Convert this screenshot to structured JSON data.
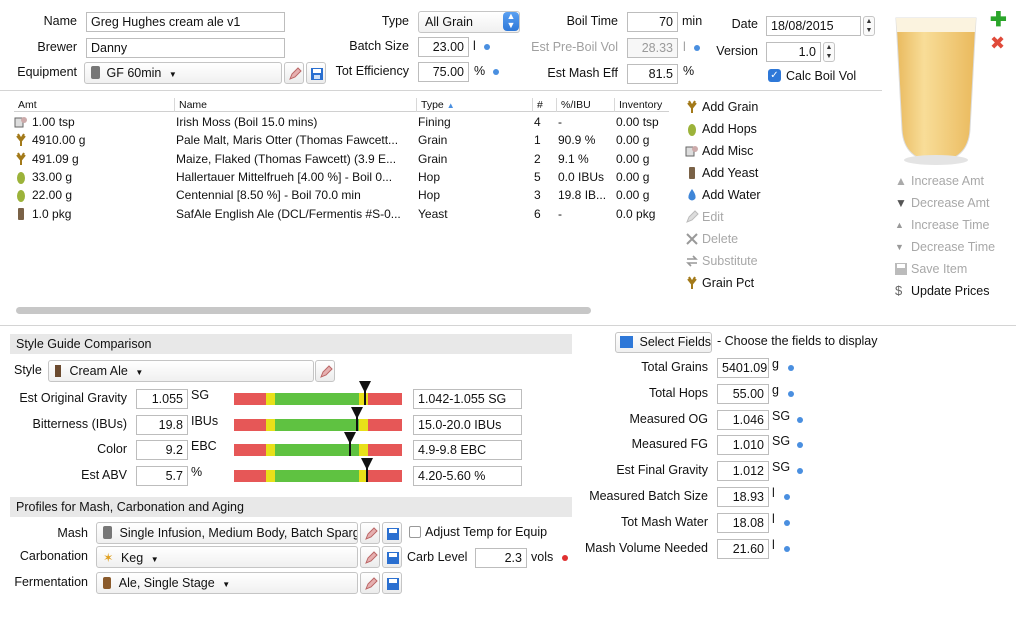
{
  "recipe": {
    "name_label": "Name",
    "name_value": "Greg Hughes cream ale v1",
    "brewer_label": "Brewer",
    "brewer_value": "Danny",
    "equipment_label": "Equipment",
    "equipment_value": "GF 60min",
    "type_label": "Type",
    "type_value": "All Grain",
    "batch_label": "Batch Size",
    "batch_value": "23.00",
    "batch_unit": "l",
    "eff_label": "Tot Efficiency",
    "eff_value": "75.00",
    "eff_unit": "%",
    "boil_label": "Boil Time",
    "boil_value": "70",
    "boil_unit": "min",
    "preboil_label": "Est Pre-Boil Vol",
    "preboil_value": "28.33",
    "preboil_unit": "l",
    "mash_eff_label": "Est Mash Eff",
    "mash_eff_value": "81.5",
    "mash_eff_unit": "%",
    "date_label": "Date",
    "date_value": "18/08/2015",
    "version_label": "Version",
    "version_value": "1.0",
    "calc_boil_label": "Calc Boil Vol"
  },
  "table": {
    "headers": [
      "Amt",
      "Name",
      "Type",
      "#",
      "%/IBU",
      "Inventory"
    ],
    "rows": [
      {
        "icon": "misc-icon",
        "amt": "1.00 tsp",
        "name": "Irish Moss (Boil 15.0 mins)",
        "type": "Fining",
        "num": "4",
        "pct": "-",
        "inv": "0.00 tsp"
      },
      {
        "icon": "grain-icon",
        "amt": "4910.00 g",
        "name": "Pale Malt, Maris Otter (Thomas Fawcett...",
        "type": "Grain",
        "num": "1",
        "pct": "90.9 %",
        "inv": "0.00 g"
      },
      {
        "icon": "grain-icon",
        "amt": "491.09 g",
        "name": "Maize, Flaked (Thomas Fawcett) (3.9 E...",
        "type": "Grain",
        "num": "2",
        "pct": "9.1 %",
        "inv": "0.00 g"
      },
      {
        "icon": "hop-icon",
        "amt": "33.00 g",
        "name": "Hallertauer Mittelfrueh [4.00 %] - Boil 0...",
        "type": "Hop",
        "num": "5",
        "pct": "0.0 IBUs",
        "inv": "0.00 g"
      },
      {
        "icon": "hop-icon",
        "amt": "22.00 g",
        "name": "Centennial [8.50 %] - Boil 70.0 min",
        "type": "Hop",
        "num": "3",
        "pct": "19.8 IB...",
        "inv": "0.00 g"
      },
      {
        "icon": "yeast-icon",
        "amt": "1.0 pkg",
        "name": "SafAle English Ale (DCL/Fermentis #S-0...",
        "type": "Yeast",
        "num": "6",
        "pct": "-",
        "inv": "0.0 pkg"
      }
    ]
  },
  "actions": {
    "add_grain": "Add Grain",
    "add_hops": "Add Hops",
    "add_misc": "Add Misc",
    "add_yeast": "Add Yeast",
    "add_water": "Add Water",
    "edit": "Edit",
    "delete": "Delete",
    "substitute": "Substitute",
    "grain_pct": "Grain Pct"
  },
  "right_actions": {
    "inc_amt": "Increase Amt",
    "dec_amt": "Decrease Amt",
    "inc_time": "Increase Time",
    "dec_time": "Decrease Time",
    "save_item": "Save Item",
    "update_prices": "Update Prices"
  },
  "style": {
    "header": "Style Guide Comparison",
    "style_label": "Style",
    "style_value": "Cream Ale",
    "rows": [
      {
        "label": "Est Original Gravity",
        "value": "1.055",
        "unit": "SG",
        "range": "1.042-1.055 SG",
        "marker": 0.78
      },
      {
        "label": "Bitterness (IBUs)",
        "value": "19.8",
        "unit": "IBUs",
        "range": "15.0-20.0 IBUs",
        "marker": 0.73
      },
      {
        "label": "Color",
        "value": "9.2",
        "unit": "EBC",
        "range": "4.9-9.8 EBC",
        "marker": 0.69
      },
      {
        "label": "Est ABV",
        "value": "5.7",
        "unit": "%",
        "range": "4.20-5.60 %",
        "marker": 0.79
      }
    ]
  },
  "profiles": {
    "header": "Profiles for Mash, Carbonation and Aging",
    "mash_label": "Mash",
    "mash_value": "Single Infusion, Medium Body, Batch Sparge",
    "adjust_label": "Adjust Temp for Equip",
    "carb_label": "Carbonation",
    "carb_value": "Keg",
    "carb_level_label": "Carb Level",
    "carb_level_value": "2.3",
    "carb_level_unit": "vols",
    "ferm_label": "Fermentation",
    "ferm_value": "Ale, Single Stage"
  },
  "fields": {
    "select_button": "Select Fields",
    "hint": "- Choose the fields to display",
    "rows": [
      {
        "label": "Total Grains",
        "value": "5401.09",
        "unit": "g"
      },
      {
        "label": "Total Hops",
        "value": "55.00",
        "unit": "g"
      },
      {
        "label": "Measured OG",
        "value": "1.046",
        "unit": "SG"
      },
      {
        "label": "Measured FG",
        "value": "1.010",
        "unit": "SG"
      },
      {
        "label": "Est Final Gravity",
        "value": "1.012",
        "unit": "SG"
      },
      {
        "label": "Measured Batch Size",
        "value": "18.93",
        "unit": "l"
      },
      {
        "label": "Tot Mash Water",
        "value": "18.08",
        "unit": "l"
      },
      {
        "label": "Mash Volume Needed",
        "value": "21.60",
        "unit": "l"
      }
    ]
  },
  "colors": {
    "accent": "#2e78d8",
    "dot": "#4a8fe0",
    "red": "#e03030",
    "beer": "#f3cf7c"
  }
}
